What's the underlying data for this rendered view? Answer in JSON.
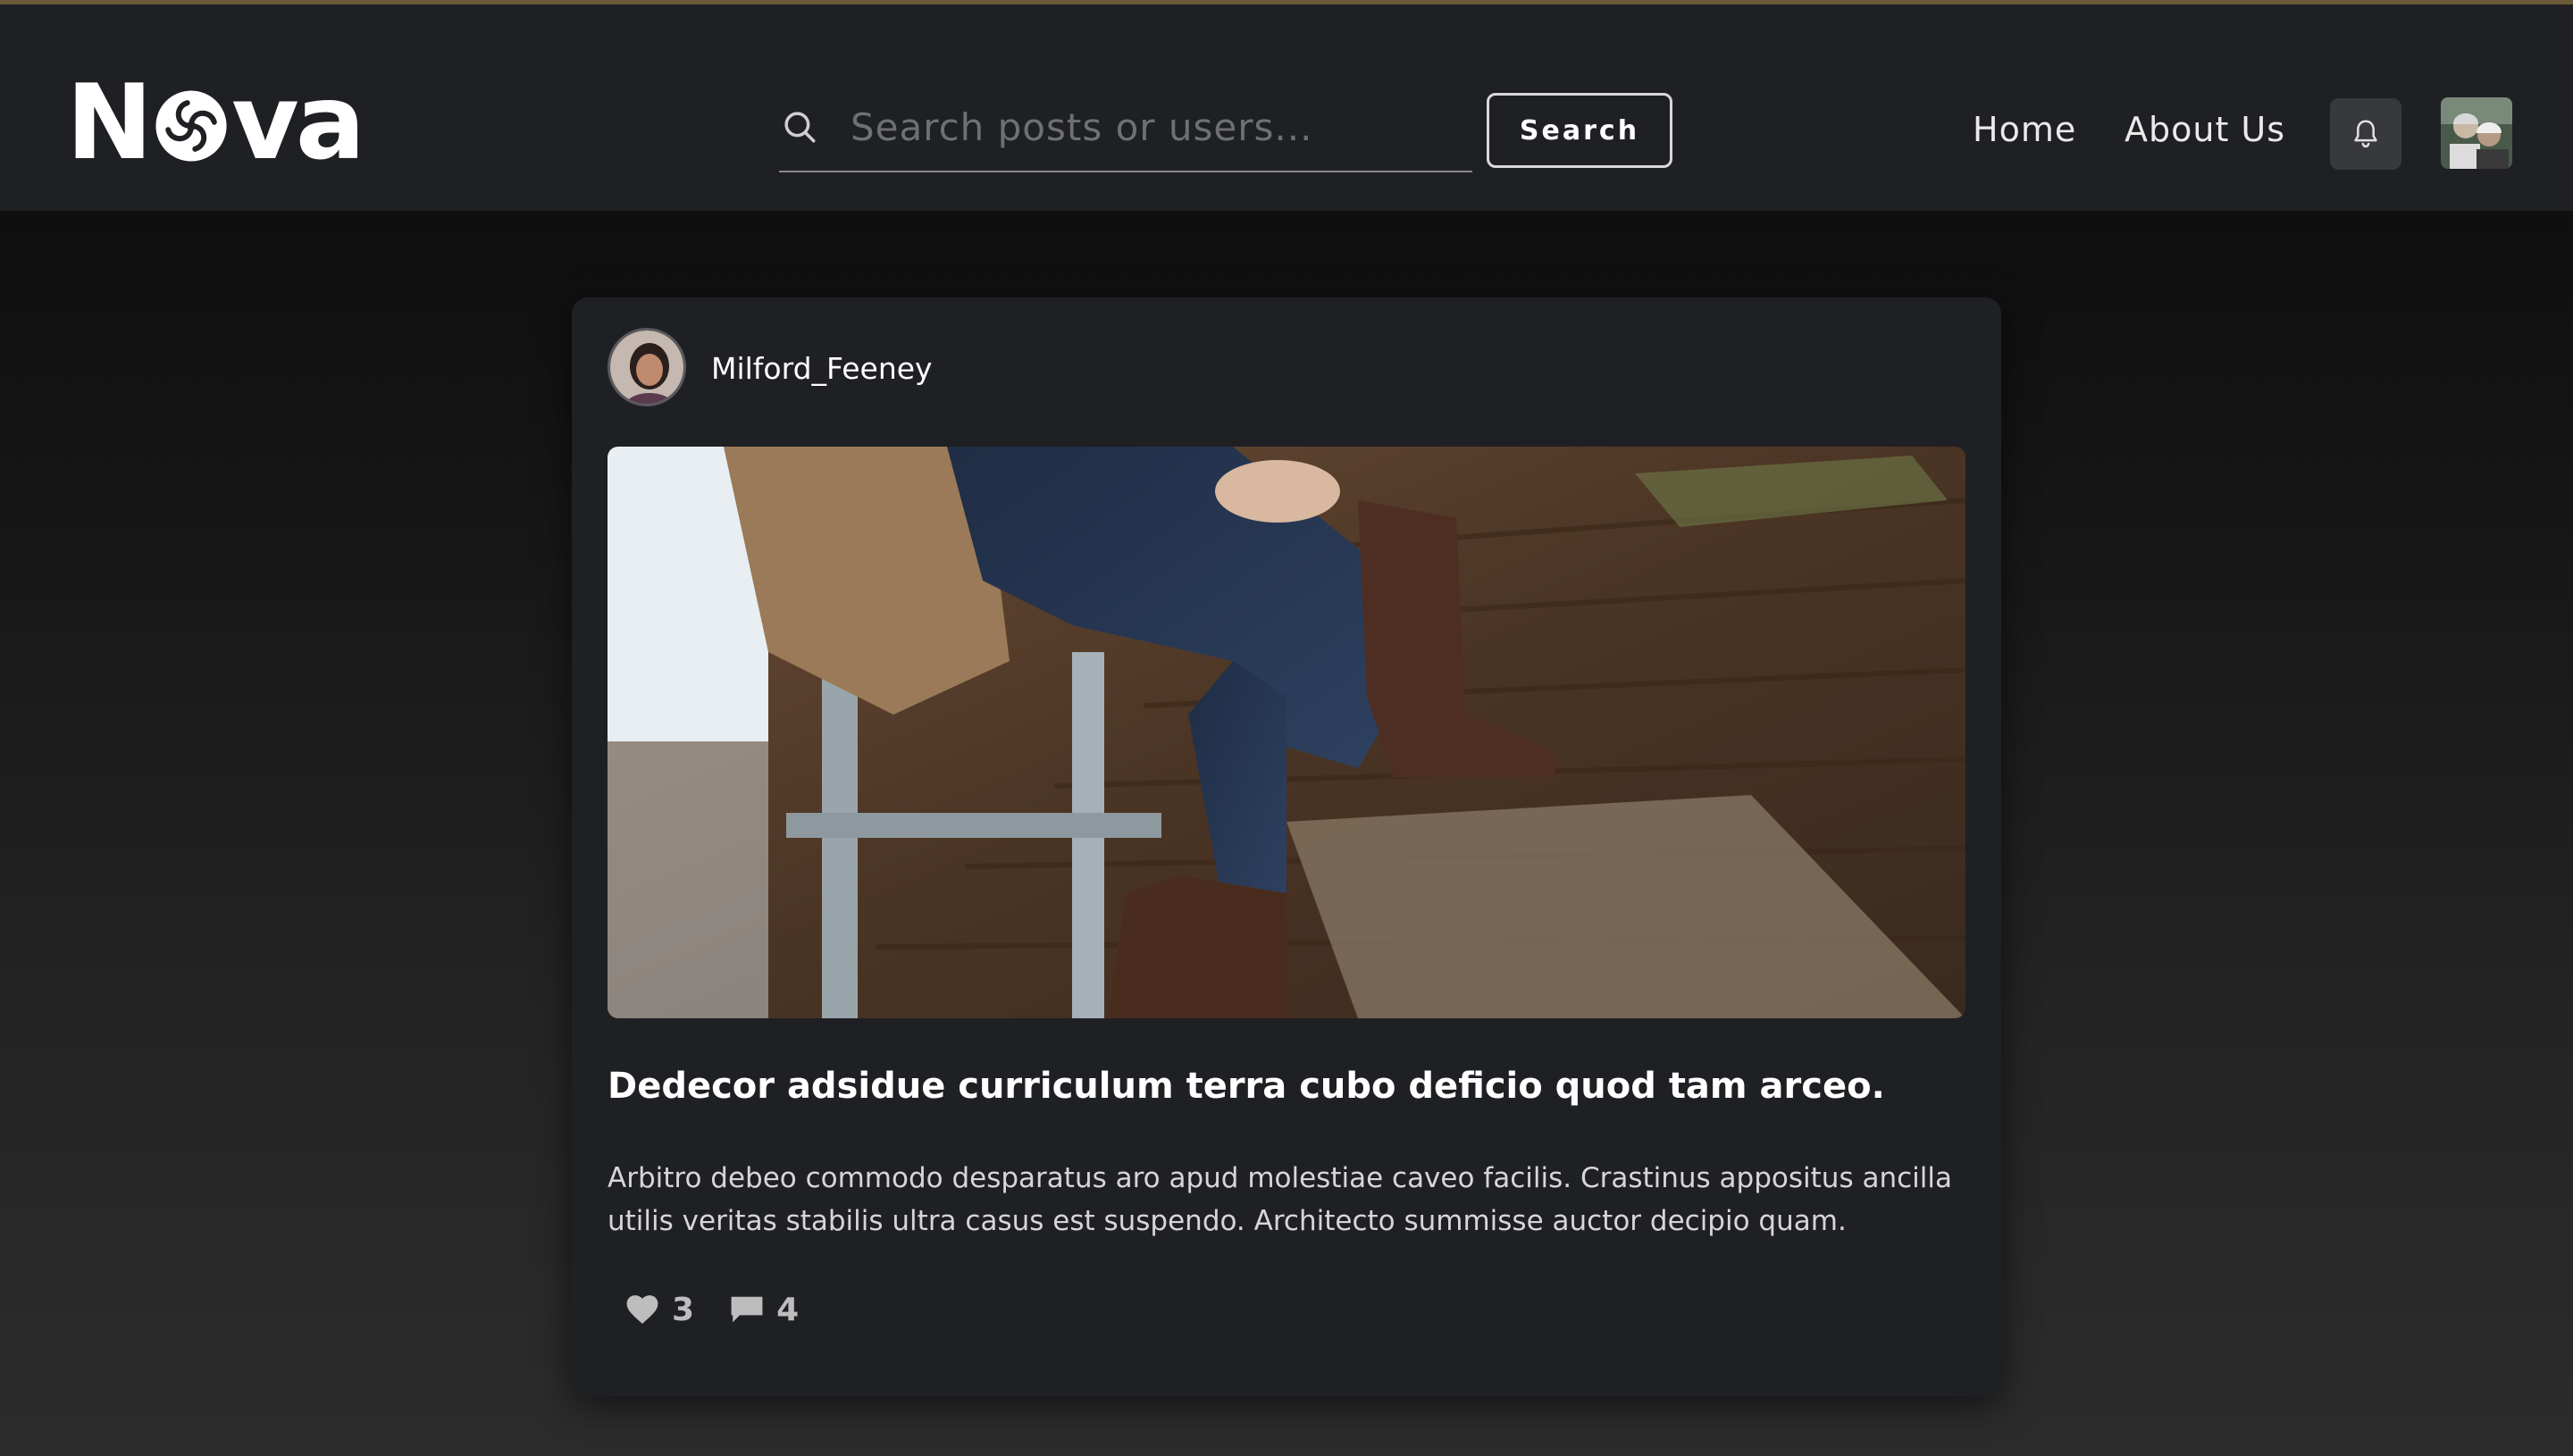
{
  "colors": {
    "header_bg": "#1f2024",
    "card_bg": "#1f2024",
    "accent_line": "#6b5a3a",
    "text_primary": "#ffffff",
    "text_secondary": "#d6d6d8",
    "icon_muted": "#bdbdbd"
  },
  "header": {
    "logo_text_prefix": "N",
    "logo_text_suffix": "va",
    "logo_icon": "swirl-icon",
    "search": {
      "icon": "search-icon",
      "placeholder": "Search posts or users...",
      "button_label": "Search"
    },
    "nav": [
      {
        "label": "Home"
      },
      {
        "label": "About Us"
      }
    ],
    "notification_icon": "bell-icon",
    "user_avatar": "avatar"
  },
  "post": {
    "author": "Milford_Feeney",
    "image_alt": "person-in-jeans-and-boots",
    "title": "Dedecor adsidue curriculum terra cubo deficio quod tam arceo.",
    "body": "Arbitro debeo commodo desparatus aro apud molestiae caveo facilis. Crastinus appositus ancilla utilis veritas stabilis ultra casus est suspendo. Architecto summisse auctor decipio quam.",
    "likes": "3",
    "comments": "4",
    "like_icon": "heart-icon",
    "comment_icon": "comment-icon"
  }
}
